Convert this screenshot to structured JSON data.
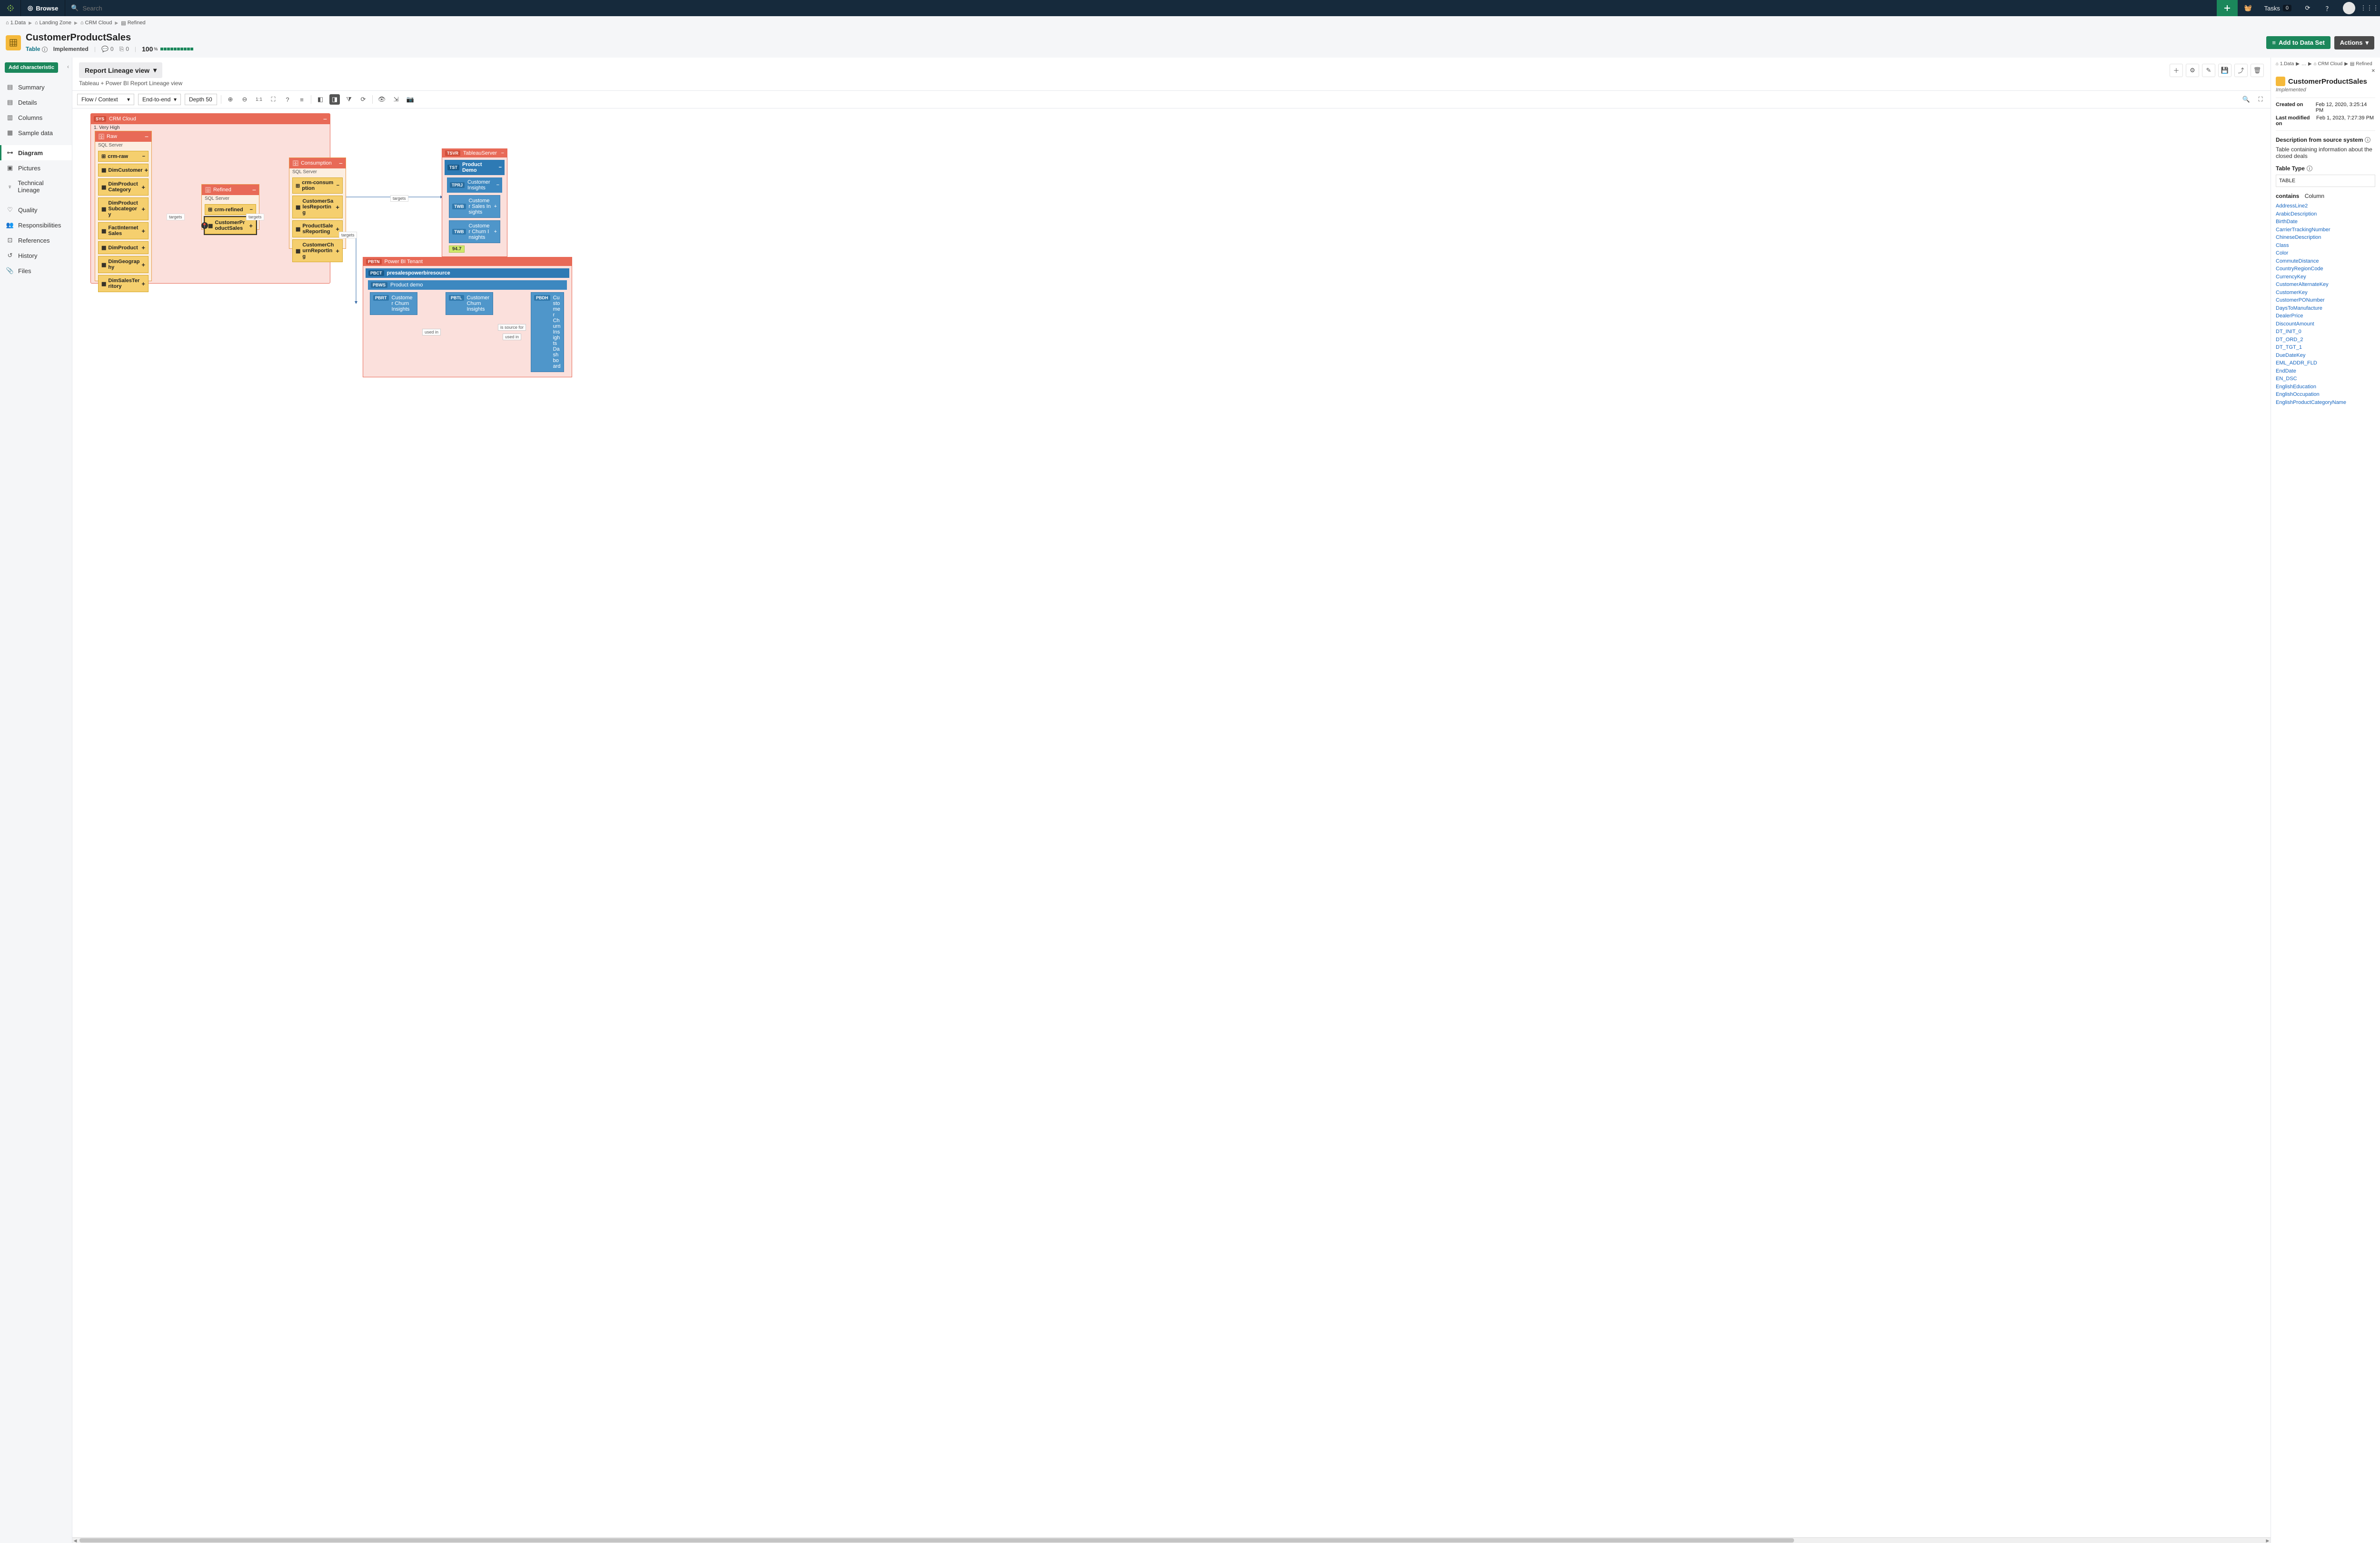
{
  "topbar": {
    "browse": "Browse",
    "search_placeholder": "Search",
    "tasks_label": "Tasks",
    "tasks_count": "0"
  },
  "breadcrumb": {
    "items": [
      "1.Data",
      "Landing Zone",
      "CRM Cloud",
      "Refined"
    ]
  },
  "asset": {
    "title": "CustomerProductSales",
    "type": "Table",
    "status": "Implemented",
    "comments": "0",
    "watches": "0",
    "trust_pct": "100",
    "trust_pct_unit": "%"
  },
  "header_actions": {
    "add_to_ds": "Add to Data Set",
    "actions": "Actions"
  },
  "left_nav": {
    "add_char": "Add characteristic",
    "items_a": [
      "Summary",
      "Details",
      "Columns",
      "Sample data"
    ],
    "diagram": "Diagram",
    "items_b": [
      "Pictures",
      "Technical Lineage"
    ],
    "items_c": [
      "Quality",
      "Responsibilities",
      "References",
      "History",
      "Files"
    ]
  },
  "view": {
    "title": "Report Lineage view",
    "desc": "Tableau + Power BI Report Lineage view"
  },
  "toolbar": {
    "flow": "Flow / Context",
    "scope": "End-to-end",
    "depth": "Depth 50",
    "oneone": "1:1"
  },
  "canvas": {
    "crm_sys_tag": "SYS",
    "crm_sys": "CRM Cloud",
    "crm_rating": "1. Very High",
    "raw": "Raw",
    "raw_sub": "SQL Server",
    "crm_raw_db": "crm-raw",
    "raw_tables": [
      "DimCustomer",
      "DimProductCategory",
      "DimProductSubcategory",
      "FactInternetSales",
      "DimProduct",
      "DimGeography",
      "DimSalesTerritory"
    ],
    "refined": "Refined",
    "refined_sub": "SQL Server",
    "crm_refined_db": "crm-refined",
    "cust_prod": "CustomerProductSales",
    "consumption": "Consumption",
    "consumption_sub": "SQL Server",
    "crm_consumption_db": "crm-consumption",
    "cons_tables": [
      "CustomerSalesReporting",
      "ProductSalesReporting",
      "CustomerChurnReporting"
    ],
    "edge_targets": "targets",
    "tsvr_tag": "TSVR",
    "tsvr": "TableauServer",
    "tst_tag": "TST",
    "tst": "Product Demo",
    "tprj_tag": "TPRJ",
    "tprj": "Customer Insights",
    "twb_tag": "TWB",
    "twb1": "Customer Sales Insights",
    "twb2": "Customer Churn Insights",
    "badge": "94.7",
    "pb_tag": "PBTN",
    "pb": "Power BI Tenant",
    "pbct_tag": "PBCT",
    "pbct": "presalespowerbiresource",
    "pbws_tag": "PBWS",
    "pbws": "Product demo",
    "pbrt_tag": "PBRT",
    "pbrt": "Customer Churn Insights",
    "pbtl_tag": "PBTL",
    "pbtl": "Customer Churn Insights",
    "pbdh_tag": "PBDH",
    "pbdh": "Customer Churn Insights Dashboard",
    "used_in": "used in",
    "is_source": "is source for"
  },
  "right": {
    "bc": [
      "1.Data",
      "…",
      "CRM Cloud",
      "Refined"
    ],
    "title": "CustomerProductSales",
    "impl": "Implemented",
    "created_lbl": "Created on",
    "created": "Feb 12, 2020, 3:25:14 PM",
    "modified_lbl": "Last modified on",
    "modified": "Feb 1, 2023, 7:27:39 PM",
    "desc_hdr": "Description from source system",
    "desc": "Table containing information about the closed deals",
    "table_type_hdr": "Table Type",
    "table_type": "TABLE",
    "contains_hdr_a": "contains",
    "contains_hdr_b": "Column",
    "columns": [
      "AddressLine2",
      "ArabicDescription",
      "BirthDate",
      "CarrierTrackingNumber",
      "ChineseDescription",
      "Class",
      "Color",
      "CommuteDistance",
      "CountryRegionCode",
      "CurrencyKey",
      "CustomerAlternateKey",
      "CustomerKey",
      "CustomerPONumber",
      "DaysToManufacture",
      "DealerPrice",
      "DiscountAmount",
      "DT_INIT_0",
      "DT_ORD_2",
      "DT_TGT_1",
      "DueDateKey",
      "EML_ADDR_FLD",
      "EndDate",
      "EN_DSC",
      "EnglishEducation",
      "EnglishOccupation",
      "EnglishProductCategoryName"
    ]
  }
}
